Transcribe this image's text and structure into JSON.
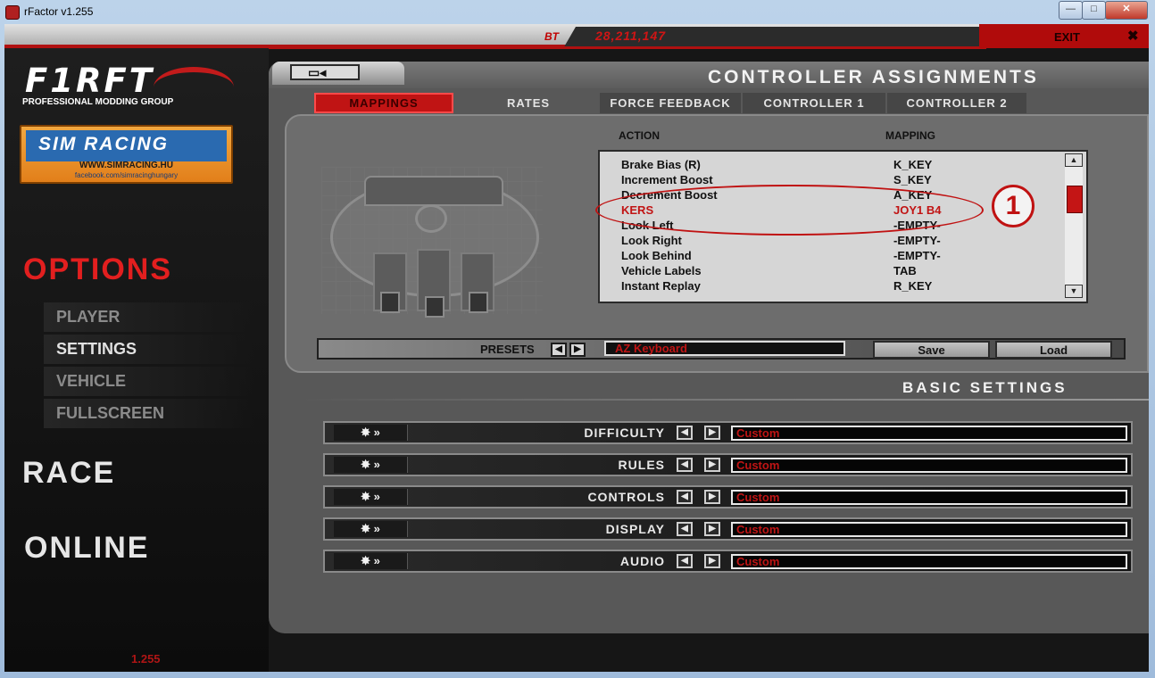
{
  "window": {
    "title": "rFactor v1.255",
    "controls": {
      "minimize": "—",
      "maximize": "□",
      "close": "✕"
    }
  },
  "topbar": {
    "bt_label": "BT",
    "bt_value": "28,211,147",
    "exit_label": "EXIT",
    "exit_icon": "close-x-icon"
  },
  "sidebar": {
    "logo_text": "F1RFT",
    "logo_subtitle": "PROFESSIONAL MODDING GROUP",
    "badge": {
      "title": "SIM RACING",
      "url": "WWW.SIMRACING.HU",
      "social": "facebook.com/simracinghungary"
    },
    "options_title": "OPTIONS",
    "options_items": [
      {
        "label": "PLAYER",
        "active": false
      },
      {
        "label": "SETTINGS",
        "active": true
      },
      {
        "label": "VEHICLE",
        "active": false
      },
      {
        "label": "FULLSCREEN",
        "active": false
      }
    ],
    "race_title": "RACE",
    "online_title": "ONLINE",
    "version": "1.255"
  },
  "main": {
    "title": "CONTROLLER ASSIGNMENTS",
    "tabs": [
      {
        "label": "MAPPINGS",
        "active": true
      },
      {
        "label": "RATES",
        "active": false
      },
      {
        "label": "FORCE FEEDBACK",
        "active": false
      },
      {
        "label": "CONTROLLER 1",
        "active": false
      },
      {
        "label": "CONTROLLER 2",
        "active": false
      }
    ],
    "columns": {
      "action": "ACTION",
      "mapping": "MAPPING"
    },
    "mappings": [
      {
        "action": "Brake Bias (R)",
        "mapping": "K_KEY",
        "highlighted": false
      },
      {
        "action": "Increment Boost",
        "mapping": "S_KEY",
        "highlighted": false
      },
      {
        "action": "Decrement Boost",
        "mapping": "A_KEY",
        "highlighted": false
      },
      {
        "action": "KERS",
        "mapping": "JOY1 B4",
        "highlighted": true
      },
      {
        "action": "Look Left",
        "mapping": "-EMPTY-",
        "highlighted": false
      },
      {
        "action": "Look Right",
        "mapping": "-EMPTY-",
        "highlighted": false
      },
      {
        "action": "Look Behind",
        "mapping": "-EMPTY-",
        "highlighted": false
      },
      {
        "action": "Vehicle Labels",
        "mapping": "TAB",
        "highlighted": false
      },
      {
        "action": "Instant Replay",
        "mapping": "R_KEY",
        "highlighted": false
      }
    ],
    "callout_number": "1",
    "presets": {
      "label": "PRESETS",
      "value": "AZ Keyboard",
      "save_label": "Save",
      "load_label": "Load"
    },
    "basic_settings_title": "BASIC SETTINGS",
    "basic_settings": [
      {
        "label": "DIFFICULTY",
        "value": "Custom"
      },
      {
        "label": "RULES",
        "value": "Custom"
      },
      {
        "label": "CONTROLS",
        "value": "Custom"
      },
      {
        "label": "DISPLAY",
        "value": "Custom"
      },
      {
        "label": "AUDIO",
        "value": "Custom"
      }
    ],
    "row_icon_glyph": "✸ »"
  },
  "colors": {
    "accent_red": "#c01414",
    "panel_gray": "#585858",
    "background": "#161616"
  }
}
